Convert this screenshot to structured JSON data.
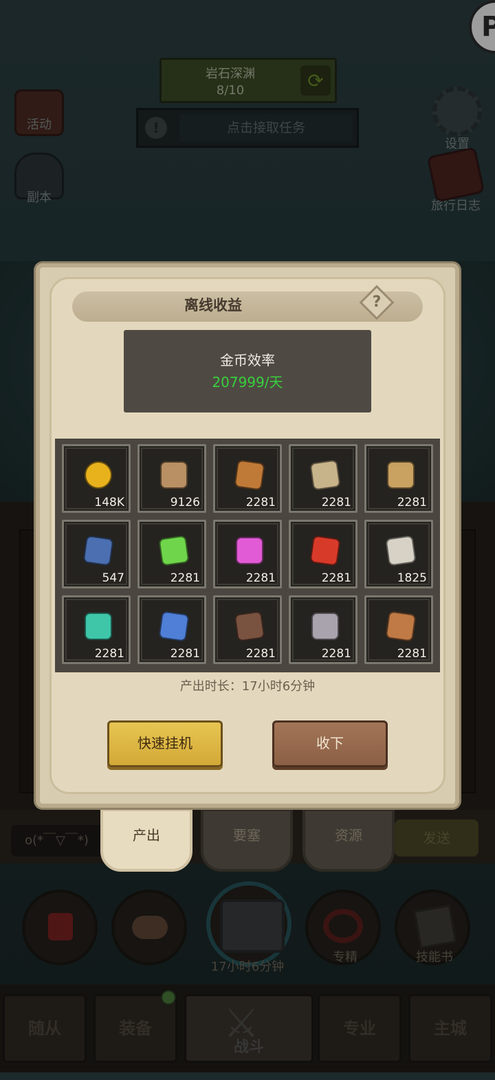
{
  "top_hud": {
    "stage_name": "岩石深渊",
    "stage_progress": "8/10",
    "task_text": "点击接取任务",
    "left_buttons": [
      {
        "label": "活动"
      },
      {
        "label": "副本"
      }
    ],
    "right_buttons": [
      {
        "label": "设置"
      },
      {
        "label": "旅行日志"
      }
    ]
  },
  "modal": {
    "title": "离线收益",
    "efficiency_label": "金币效率",
    "efficiency_value": "207999/天",
    "items": [
      {
        "icon": "gold-coin-icon",
        "qty": "148K",
        "color": "#e8b21d"
      },
      {
        "icon": "wood-log-icon",
        "qty": "9126",
        "color": "#b89063"
      },
      {
        "icon": "meat-icon",
        "qty": "2281",
        "color": "#c07a38"
      },
      {
        "icon": "cloth-icon",
        "qty": "2281",
        "color": "#c8b48a"
      },
      {
        "icon": "leather-icon",
        "qty": "2281",
        "color": "#c9a161"
      },
      {
        "icon": "rune-stone-icon",
        "qty": "547",
        "color": "#4b6fb0"
      },
      {
        "icon": "green-crystal-icon",
        "qty": "2281",
        "color": "#6fd64b"
      },
      {
        "icon": "pink-scroll-icon",
        "qty": "2281",
        "color": "#e25bd6"
      },
      {
        "icon": "red-crystal-icon",
        "qty": "2281",
        "color": "#d83a2a"
      },
      {
        "icon": "paper-scroll-icon",
        "qty": "1825",
        "color": "#d8d2c6"
      },
      {
        "icon": "teal-gem-icon",
        "qty": "2281",
        "color": "#3fc6a9"
      },
      {
        "icon": "blue-fabric-icon",
        "qty": "2281",
        "color": "#4f7fd6"
      },
      {
        "icon": "brown-ore-icon",
        "qty": "2281",
        "color": "#7a5240"
      },
      {
        "icon": "grey-stone-icon",
        "qty": "2281",
        "color": "#a8a3ad"
      },
      {
        "icon": "copper-ingot-icon",
        "qty": "2281",
        "color": "#c07a45"
      }
    ],
    "duration_text": "产出时长：17小时6分钟",
    "quick_idle_label": "快速挂机",
    "collect_label": "收下"
  },
  "chat": {
    "input_value": "o(*￣▽￣*)",
    "send_label": "发送",
    "tabs": [
      {
        "label": "产出"
      },
      {
        "label": "要塞"
      },
      {
        "label": "资源"
      }
    ]
  },
  "actions": {
    "chest_timer": "17小时6分钟",
    "elite_label": "专精",
    "skillbook_label": "技能书"
  },
  "nav": {
    "items": [
      {
        "label": "随从"
      },
      {
        "label": "装备"
      },
      {
        "label": "战斗"
      },
      {
        "label": "专业"
      },
      {
        "label": "主城"
      }
    ]
  }
}
